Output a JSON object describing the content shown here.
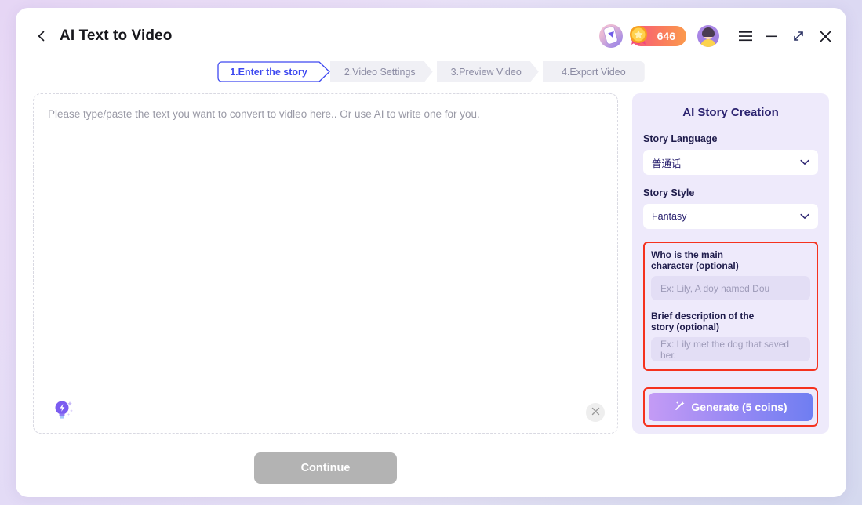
{
  "titlebar": {
    "back_icon": "chevron-left-icon",
    "title": "AI Text to Video",
    "app_icon": "mobile-app-download-icon",
    "coins": "646",
    "coin_icon": "gold-star-medal-icon",
    "avatar_icon": "user-avatar",
    "menu_icon": "hamburger-menu-icon",
    "minimize_icon": "minimize-icon",
    "maximize_icon": "expand-icon",
    "close_icon": "close-icon"
  },
  "stepper": {
    "steps": [
      {
        "label": "1.Enter the story",
        "active": true
      },
      {
        "label": "2.Video Settings",
        "active": false
      },
      {
        "label": "3.Preview Video",
        "active": false
      },
      {
        "label": "4.Export Video",
        "active": false
      }
    ]
  },
  "editor": {
    "placeholder": "Please type/paste the text you want to convert to vidleo here.. Or use AI to write one for you.",
    "value": "",
    "bulb_icon": "lightbulb-idea-icon",
    "clear_icon": "clear-close-icon"
  },
  "footer": {
    "continue_label": "Continue",
    "continue_disabled": true
  },
  "panel": {
    "title": "AI Story Creation",
    "language_label": "Story Language",
    "language_value": "普通话",
    "style_label": "Story Style",
    "style_value": "Fantasy",
    "chevron_icon": "chevron-down-icon",
    "character_label": "Who is the main character",
    "character_optional": "(optional)",
    "character_placeholder": "Ex: Lily, A doy named Dou",
    "character_value": "",
    "description_label": "Brief description of the story",
    "description_optional": "(optional)",
    "description_placeholder": "Ex: Lily met the dog that saved her.",
    "description_value": "",
    "generate_label": "Generate (5 coins)",
    "generate_icon": "magic-wand-icon"
  },
  "colors": {
    "accent": "#3d48f0",
    "highlight": "#f5321e",
    "panel_bg": "#eeeafb",
    "coin_badge": "#f7567f"
  }
}
